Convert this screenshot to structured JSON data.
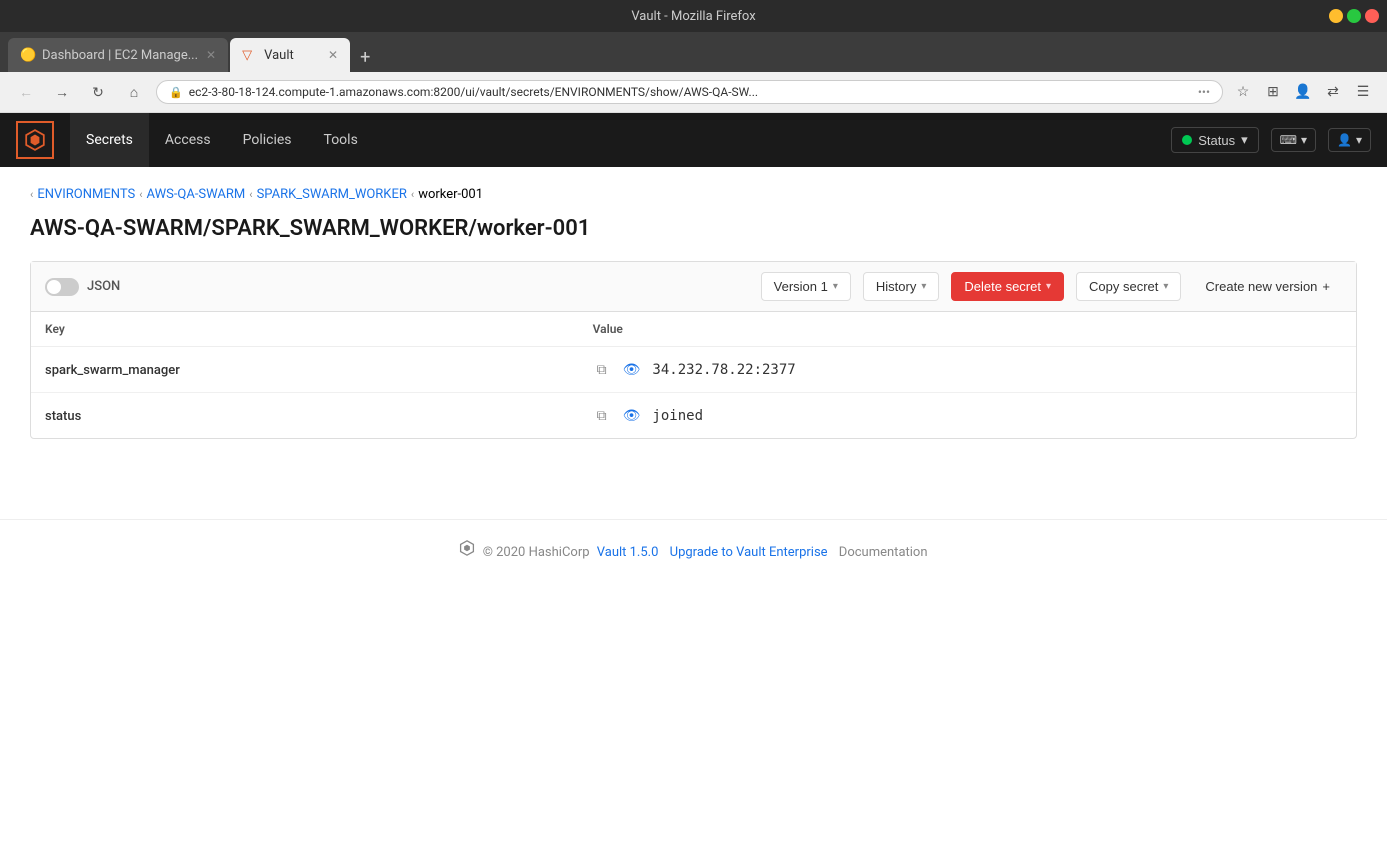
{
  "browser": {
    "title": "Vault - Mozilla Firefox",
    "tabs": [
      {
        "id": "tab1",
        "label": "Dashboard | EC2 Manage...",
        "favicon": "🟡",
        "active": false
      },
      {
        "id": "tab2",
        "label": "Vault",
        "favicon": "▽",
        "active": true
      }
    ],
    "url": "ec2-3-80-18-124.compute-1.amazonaws.com:8200/ui/vault/secrets/ENVIRONMENTS/show/AWS-QA-SW...",
    "new_tab_label": "+"
  },
  "app_nav": {
    "logo_alt": "Vault logo",
    "links": [
      {
        "id": "secrets",
        "label": "Secrets",
        "active": true
      },
      {
        "id": "access",
        "label": "Access",
        "active": false
      },
      {
        "id": "policies",
        "label": "Policies",
        "active": false
      },
      {
        "id": "tools",
        "label": "Tools",
        "active": false
      }
    ],
    "status_label": "Status",
    "status_chevron": "▾"
  },
  "breadcrumb": {
    "items": [
      {
        "label": "ENVIRONMENTS",
        "href": "#"
      },
      {
        "label": "AWS-QA-SWARM",
        "href": "#"
      },
      {
        "label": "SPARK_SWARM_WORKER",
        "href": "#"
      },
      {
        "label": "worker-001",
        "href": null
      }
    ]
  },
  "page": {
    "title": "AWS-QA-SWARM/SPARK_SWARM_WORKER/worker-001"
  },
  "toolbar": {
    "json_label": "JSON",
    "version_label": "Version 1",
    "history_label": "History",
    "delete_label": "Delete secret",
    "copy_label": "Copy secret",
    "create_label": "Create new version",
    "create_icon": "+"
  },
  "table": {
    "col_key": "Key",
    "col_value": "Value",
    "rows": [
      {
        "key": "spark_swarm_manager",
        "value": "34.232.78.22:2377"
      },
      {
        "key": "status",
        "value": "joined"
      }
    ]
  },
  "footer": {
    "copyright": "© 2020 HashiCorp",
    "vault_version": "Vault 1.5.0",
    "upgrade_label": "Upgrade to Vault Enterprise",
    "docs_label": "Documentation"
  }
}
